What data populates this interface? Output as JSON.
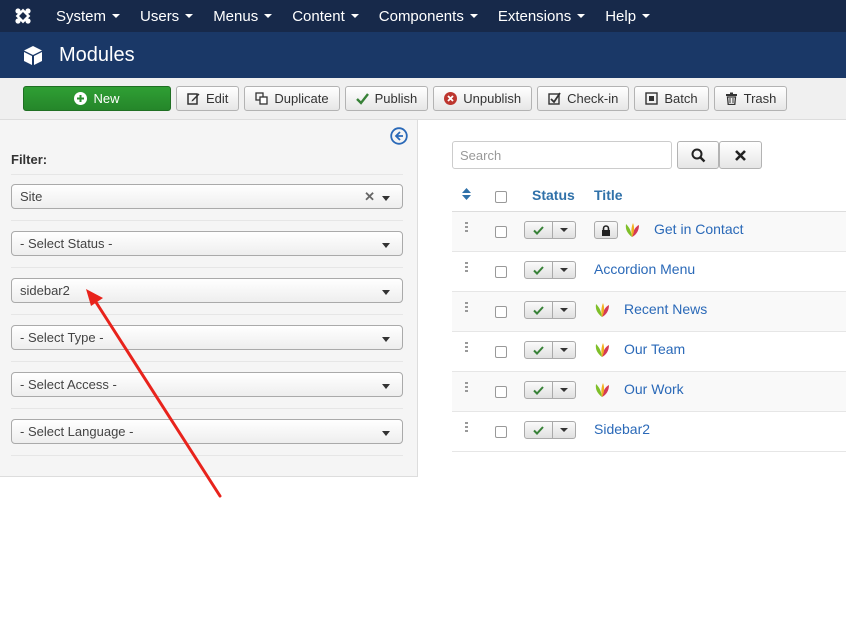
{
  "nav": {
    "items": [
      {
        "label": "System"
      },
      {
        "label": "Users"
      },
      {
        "label": "Menus"
      },
      {
        "label": "Content"
      },
      {
        "label": "Components"
      },
      {
        "label": "Extensions"
      },
      {
        "label": "Help"
      }
    ]
  },
  "header": {
    "title": "Modules"
  },
  "toolbar": {
    "new_label": "New",
    "edit_label": "Edit",
    "duplicate_label": "Duplicate",
    "publish_label": "Publish",
    "unpublish_label": "Unpublish",
    "checkin_label": "Check-in",
    "batch_label": "Batch",
    "trash_label": "Trash"
  },
  "filter": {
    "label": "Filter:",
    "site": "Site",
    "status": "- Select Status -",
    "position": "sidebar2",
    "type": "- Select Type -",
    "access": "- Select Access -",
    "language": "- Select Language -"
  },
  "search": {
    "placeholder": "Search"
  },
  "table": {
    "status_header": "Status",
    "title_header": "Title",
    "rows": [
      {
        "title": "Get in Contact"
      },
      {
        "title": "Accordion Menu"
      },
      {
        "title": "Recent News"
      },
      {
        "title": "Our Team"
      },
      {
        "title": "Our Work"
      },
      {
        "title": "Sidebar2"
      }
    ]
  },
  "colors": {
    "nav_bg": "#17294a",
    "header_bg": "#1a3867",
    "accent": "#2a69b8",
    "new_button": "#2f9f34",
    "annotation_arrow": "#e8231c"
  }
}
